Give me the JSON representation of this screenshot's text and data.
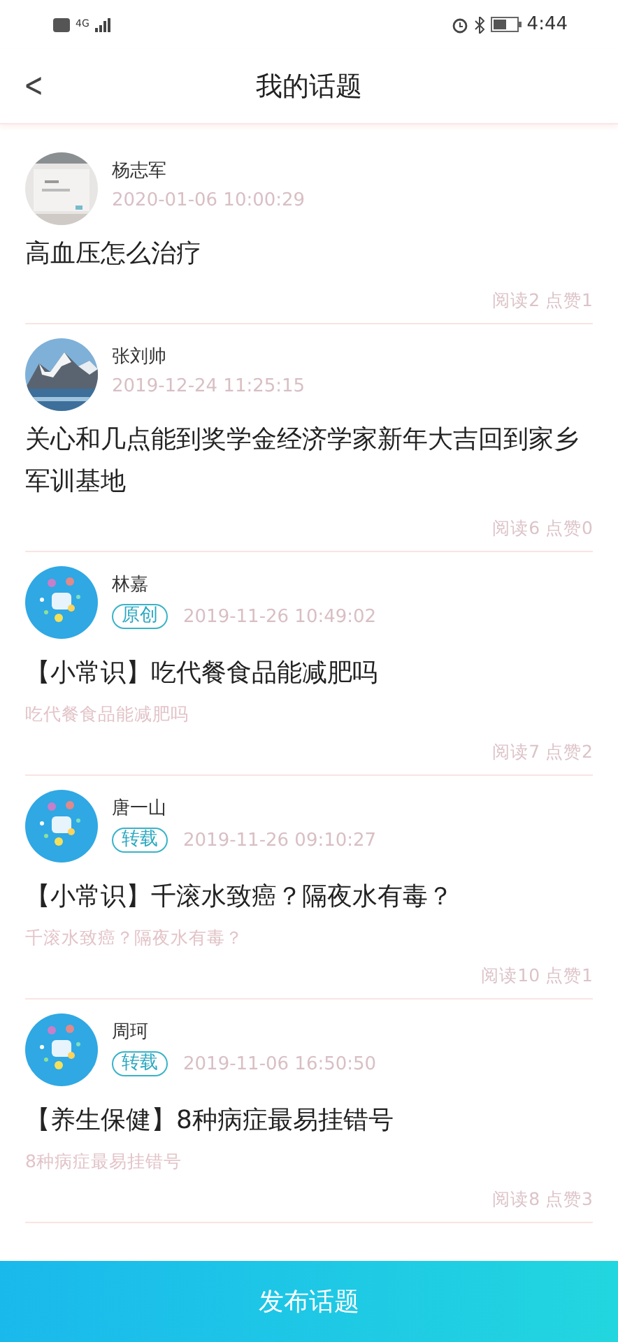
{
  "status_bar": {
    "network": "4G",
    "time": "4:44"
  },
  "header": {
    "back": "<",
    "title": "我的话题"
  },
  "topics": [
    {
      "author": "杨志军",
      "date": "2020-01-06 10:00:29",
      "title": "高血压怎么治疗",
      "stats": "阅读2 点赞1"
    },
    {
      "author": "张刘帅",
      "date": "2019-12-24 11:25:15",
      "title": "关心和几点能到奖学金经济学家新年大吉回到家乡军训基地",
      "stats": "阅读6 点赞0"
    },
    {
      "author": "林嘉",
      "tag": "原创",
      "date": "2019-11-26 10:49:02",
      "title": "【小常识】吃代餐食品能减肥吗",
      "summary": "吃代餐食品能减肥吗",
      "stats": "阅读7 点赞2"
    },
    {
      "author": "唐一山",
      "tag": "转载",
      "date": "2019-11-26 09:10:27",
      "title": "【小常识】千滚水致癌？隔夜水有毒？",
      "summary": "千滚水致癌？隔夜水有毒？",
      "stats": "阅读10 点赞1"
    },
    {
      "author": "周珂",
      "tag": "转载",
      "date": "2019-11-06 16:50:50",
      "title": "【养生保健】8种病症最易挂错号",
      "summary": "8种病症最易挂错号",
      "stats": "阅读8 点赞3"
    }
  ],
  "publish_button": "发布话题"
}
